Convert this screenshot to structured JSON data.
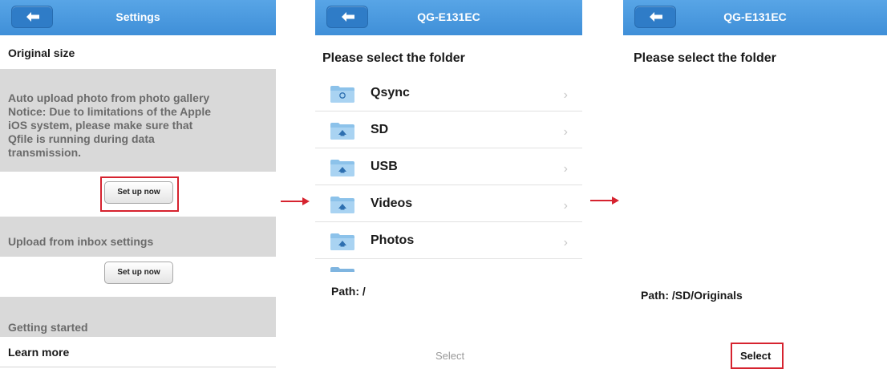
{
  "settings": {
    "title": "Settings",
    "original_size": "Original size",
    "auto_upload_lines": [
      "Auto upload photo from photo gallery",
      "Notice: Due to limitations of the Apple",
      "iOS system, please make sure that",
      "Qfile is running during data",
      "transmission."
    ],
    "setup_label_1": "Set up now",
    "inbox_section": "Upload from inbox settings",
    "setup_label_2": "Set up now",
    "getting_started": "Getting started",
    "learn_more": "Learn more"
  },
  "folder_panel": {
    "title": "QG-E131EC",
    "prompt": "Please select the folder",
    "folders": [
      {
        "name": "Qsync",
        "icon": "qsync-folder-icon"
      },
      {
        "name": "SD",
        "icon": "shared-folder-icon"
      },
      {
        "name": "USB",
        "icon": "shared-folder-icon"
      },
      {
        "name": "Videos",
        "icon": "shared-folder-icon"
      },
      {
        "name": "Photos",
        "icon": "shared-folder-icon"
      }
    ],
    "path": "Path: /",
    "select_label": "Select"
  },
  "selected_panel": {
    "title": "QG-E131EC",
    "prompt": "Please select the folder",
    "path": "Path: /SD/Originals",
    "select_label": "Select"
  },
  "icons": {
    "back": "back-arrow-icon",
    "chevron": "chevron-right-icon",
    "flow_arrow": "red-arrow-icon"
  },
  "colors": {
    "header_blue": "#4a9ae0",
    "highlight_red": "#d6232f",
    "gray_section": "#d9d9d9"
  }
}
